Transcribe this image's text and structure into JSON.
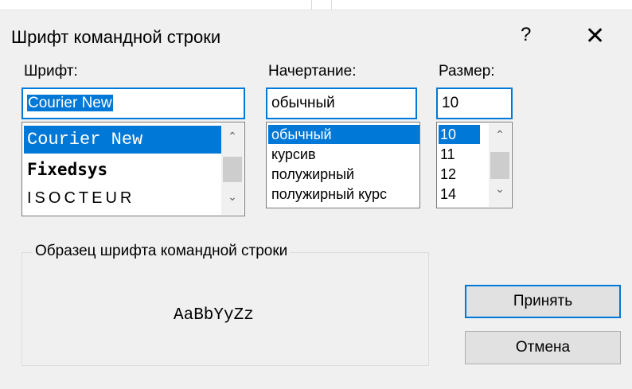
{
  "dialog": {
    "title": "Шрифт командной строки",
    "help_glyph": "?",
    "close_glyph": "✕"
  },
  "font": {
    "label": "Шрифт:",
    "value": "Courier New",
    "items": [
      "Courier New",
      "Fixedsys",
      "ISOCTEUR"
    ],
    "selected_index": 0
  },
  "style": {
    "label": "Начертание:",
    "value": "обычный",
    "items": [
      "обычный",
      "курсив",
      "полужирный",
      "полужирный курс"
    ],
    "selected_index": 0
  },
  "size": {
    "label": "Размер:",
    "value": "10",
    "items": [
      "10",
      "11",
      "12",
      "14"
    ],
    "selected_index": 0
  },
  "sample": {
    "legend": "Образец шрифта командной строки",
    "text": "AaBbYyZz"
  },
  "buttons": {
    "accept": "Принять",
    "cancel": "Отмена"
  },
  "scroll": {
    "up_glyph": "⌃",
    "down_glyph": "⌄"
  },
  "colors": {
    "accent": "#0078d7",
    "background": "#f0f0f0"
  }
}
